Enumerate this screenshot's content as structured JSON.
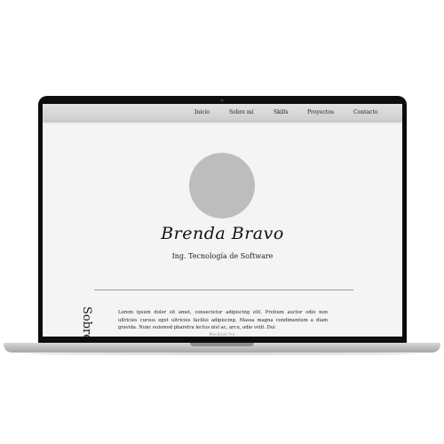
{
  "nav": {
    "items": [
      "Inicio",
      "Sobre mí",
      "Skills",
      "Proyectos",
      "Contacto"
    ]
  },
  "hero": {
    "name": "Brenda Bravo",
    "subtitle": "Ing. Tecnología de Software"
  },
  "about": {
    "side_title": "Sobre mí",
    "text": "Lorem ipsum dolor sit amet, consectetur adipiscing elit. Pretium auctor odio non ultricies cursus eget ultricies facilisi adipiscing. Massa magna condimentum a diam gravida. Nunc euismod pharetra lectus nisl ac, arcu, odio velit. Dui"
  },
  "device": {
    "label": "MacBook Pro"
  },
  "colors": {
    "screen_background": "#f4f4f4",
    "navbar": "#d8d8d8",
    "avatar_placeholder": "#bdbdbd",
    "laptop_bezel": "#0d0d0d",
    "laptop_base": "#bfbfc2"
  }
}
